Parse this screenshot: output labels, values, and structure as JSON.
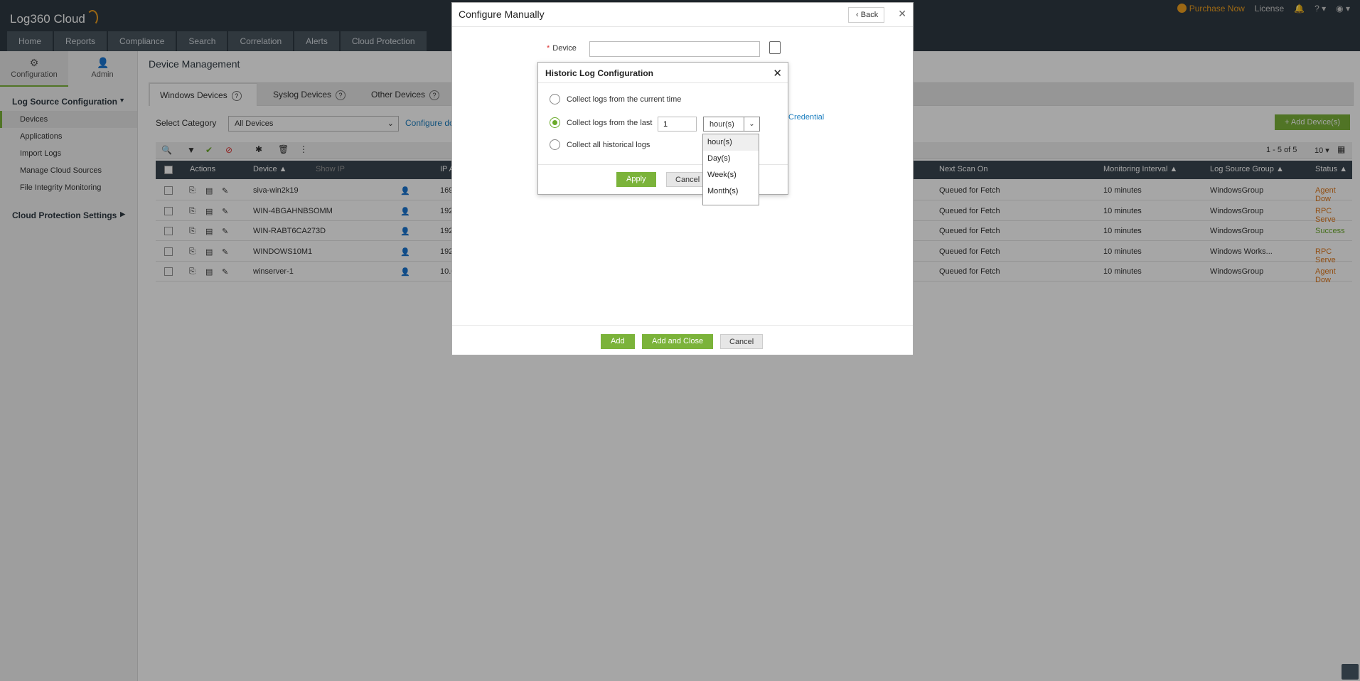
{
  "app": {
    "title": "Log360 Cloud",
    "top_right": {
      "purchase": "Purchase Now",
      "license": "License",
      "help": "?"
    },
    "nav_tabs": [
      "Home",
      "Reports",
      "Compliance",
      "Search",
      "Correlation",
      "Alerts",
      "Cloud Protection"
    ]
  },
  "left_panel": {
    "tabs": [
      "Configuration",
      "Admin"
    ],
    "section1": "Log Source Configuration",
    "items": [
      "Devices",
      "Applications",
      "Import Logs",
      "Manage Cloud Sources",
      "File Integrity Monitoring"
    ],
    "section2": "Cloud Protection Settings"
  },
  "main": {
    "page_title": "Device Management",
    "subtabs": [
      "Windows Devices",
      "Syslog Devices",
      "Other Devices"
    ],
    "category_label": "Select Category",
    "category_value": "All Devices",
    "configure_link": "Configure dom",
    "add_device": "Add Device(s)",
    "paging": "1 - 5 of 5",
    "per_page": "10",
    "columns": {
      "actions": "Actions",
      "device": "Device",
      "show_ip": "Show IP",
      "ip": "IP Ac",
      "next_scan": "Next Scan On",
      "interval": "Monitoring Interval",
      "group": "Log Source Group",
      "status": "Status"
    },
    "rows": [
      {
        "device": "siva-win2k19",
        "ip": "169.2",
        "next_scan": "Queued for Fetch",
        "interval": "10 minutes",
        "group": "WindowsGroup",
        "status": "Agent Dow",
        "status_color": "#e07a1e"
      },
      {
        "device": "WIN-4BGAHNBSOMM",
        "ip": "192.1",
        "next_scan": "Queued for Fetch",
        "interval": "10 minutes",
        "group": "WindowsGroup",
        "status": "RPC Serve",
        "status_color": "#e07a1e"
      },
      {
        "device": "WIN-RABT6CA273D",
        "ip": "192.1",
        "next_scan": "Queued for Fetch",
        "interval": "10 minutes",
        "group": "WindowsGroup",
        "status": "Success",
        "status_color": "#6aaa2a"
      },
      {
        "device": "WINDOWS10M1",
        "ip": "192.1",
        "next_scan": "Queued for Fetch",
        "interval": "10 minutes",
        "group": "Windows Works...",
        "status": "RPC Serve",
        "status_color": "#e07a1e"
      },
      {
        "device": "winserver-1",
        "ip": "10.0.",
        "next_scan": "Queued for Fetch",
        "interval": "10 minutes",
        "group": "WindowsGroup",
        "status": "Agent Dow",
        "status_color": "#e07a1e"
      }
    ]
  },
  "configure_dialog": {
    "title": "Configure Manually",
    "back": "Back",
    "device_label": "Device",
    "device_value": "",
    "credential_link": "Credential",
    "buttons": {
      "add": "Add",
      "add_close": "Add and Close",
      "cancel": "Cancel"
    }
  },
  "historic_dialog": {
    "title": "Historic Log Configuration",
    "options": {
      "current": "Collect logs from the current time",
      "last": "Collect logs from the last",
      "all": "Collect all historical logs"
    },
    "selected_option": "last",
    "last_value": "1",
    "unit_value": "hour(s)",
    "unit_options": [
      "hour(s)",
      "Day(s)",
      "Week(s)",
      "Month(s)"
    ],
    "buttons": {
      "apply": "Apply",
      "cancel": "Cancel"
    }
  }
}
